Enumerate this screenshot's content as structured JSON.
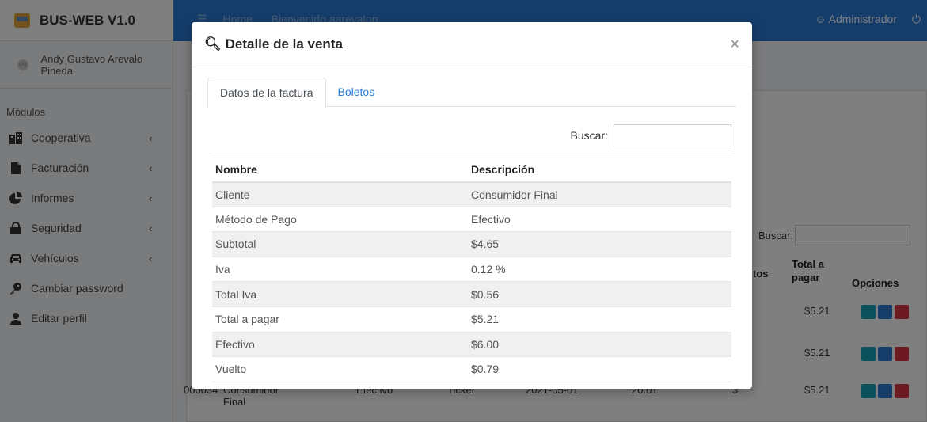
{
  "app": {
    "title": "BUS-WEB V1.0"
  },
  "sidebar": {
    "user_name": "Andy Gustavo Arevalo Pineda",
    "user_avatar_text": "(A)",
    "section_label": "Módulos",
    "items": [
      {
        "label": "Cooperativa",
        "icon": "building-icon",
        "has_submenu": true
      },
      {
        "label": "Facturación",
        "icon": "file-icon",
        "has_submenu": true
      },
      {
        "label": "Informes",
        "icon": "chart-pie-icon",
        "has_submenu": true
      },
      {
        "label": "Seguridad",
        "icon": "lock-icon",
        "has_submenu": true
      },
      {
        "label": "Vehículos",
        "icon": "car-icon",
        "has_submenu": true
      },
      {
        "label": "Cambiar password",
        "icon": "key-icon",
        "has_submenu": false
      },
      {
        "label": "Editar perfil",
        "icon": "user-icon",
        "has_submenu": false
      }
    ],
    "chevron": "‹"
  },
  "topbar": {
    "home": "Home",
    "welcome": "Bienvenido aarevalop",
    "admin": "Administrador",
    "accent": "#2b7bd6"
  },
  "background": {
    "search_label": "Buscar:",
    "headers": {
      "col_tos": "tos",
      "col_total": "Total a pagar",
      "col_options": "Opciones"
    },
    "rows": [
      {
        "total": "$5.21"
      },
      {
        "total": "$5.21"
      },
      {
        "id": "000034",
        "client": "Consumidor Final",
        "method": "Efectivo",
        "type": "Ticket",
        "date": "2021-05-01",
        "time": "20:01",
        "qty": "3",
        "total": "$5.21"
      }
    ]
  },
  "modal": {
    "title": "Detalle de la venta",
    "close": "×",
    "tabs": [
      {
        "label": "Datos de la factura",
        "active": true
      },
      {
        "label": "Boletos",
        "active": false
      }
    ],
    "search_label": "Buscar:",
    "search_value": "",
    "table": {
      "headers": [
        "Nombre",
        "Descripción"
      ],
      "rows": [
        [
          "Cliente",
          "Consumidor Final"
        ],
        [
          "Método de Pago",
          "Efectivo"
        ],
        [
          "Subtotal",
          "$4.65"
        ],
        [
          "Iva",
          "0.12 %"
        ],
        [
          "Total Iva",
          "$0.56"
        ],
        [
          "Total a pagar",
          "$5.21"
        ],
        [
          "Efectivo",
          "$6.00"
        ],
        [
          "Vuelto",
          "$0.79"
        ]
      ]
    }
  }
}
